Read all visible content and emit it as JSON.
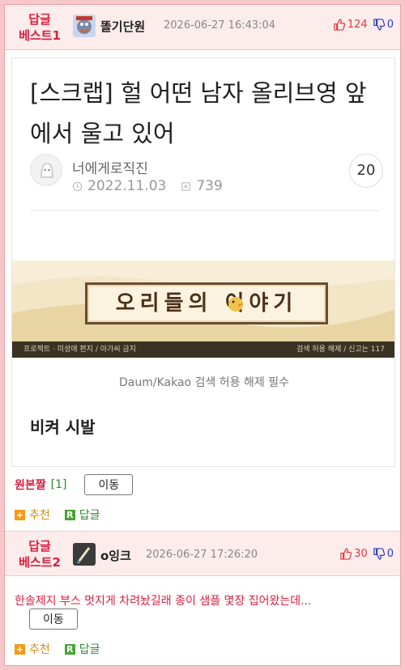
{
  "posts": [
    {
      "best_label": "답글 베스트1",
      "nickname": "똘기단원",
      "timestamp": "2026-06-27 16:43:04",
      "up_votes": "124",
      "down_votes": "0"
    },
    {
      "best_label": "답글 베스트2",
      "nickname": "o잉크",
      "timestamp": "2026-06-27 17:26:20",
      "up_votes": "30",
      "down_votes": "0",
      "preview_text": "한솔제지 부스 멋지게 차려놨길래 종이 샘플 몇장 집어왔는데..."
    }
  ],
  "scrap": {
    "title": "[스크랩] 헐 어떤 남자 올리브영 앞에서 울고 있어",
    "author": "너에게로직진",
    "date": "2022.11.03",
    "views": "739",
    "comments": "20",
    "banner_title": "오리들의 이야기",
    "banner_left": "프로젝트 · 미성애 편지 / 아가씨 금지",
    "banner_right": "검색 허용 해제 / 신고는 117",
    "caption": "Daum/Kakao 검색 허용 해제 필수",
    "body": "비켜 시발"
  },
  "source": {
    "label": "원본짤",
    "count": "[1]",
    "move_label": "이동"
  },
  "actions": {
    "recommend": "추천",
    "reply": "답글",
    "plus_glyph": "+",
    "reply_glyph": "R"
  },
  "icons": {
    "up": "thumbs-up-icon",
    "down": "thumbs-down-icon"
  },
  "colors": {
    "best_red": "#d91f3c",
    "up_red": "#e03a3a",
    "down_blue": "#2a3fb8",
    "reply_green": "#2f8a2f",
    "recommend_orange": "#f39b1a"
  }
}
